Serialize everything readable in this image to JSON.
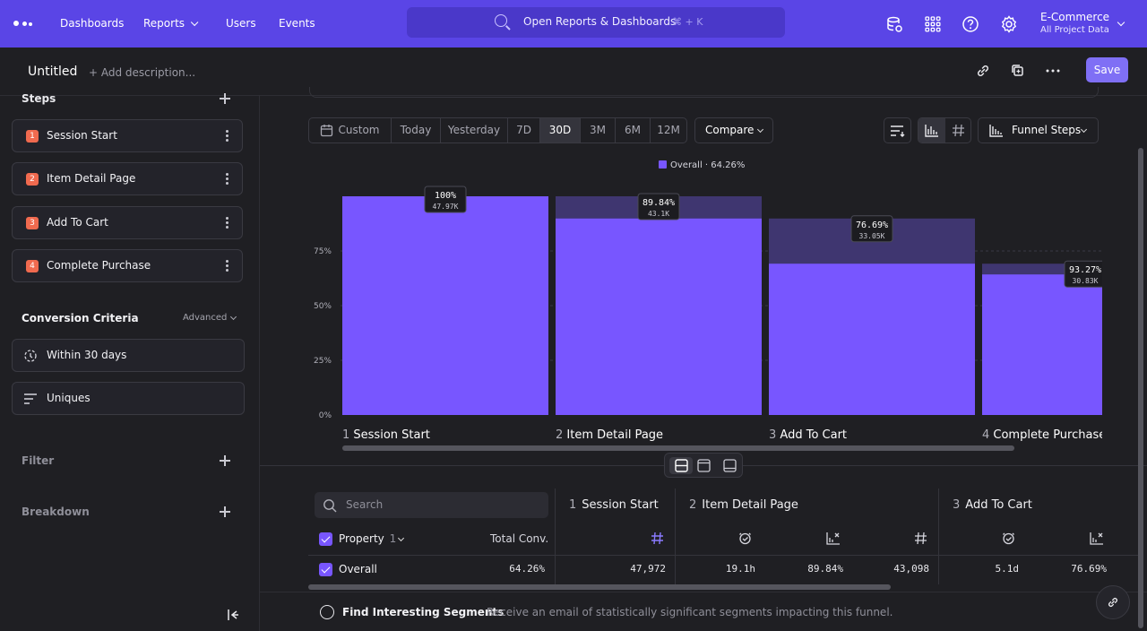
{
  "nav": {
    "links": [
      "Dashboards",
      "Reports",
      "Users",
      "Events"
    ],
    "search_text": "Open Reports & Dashboards",
    "search_shortcut": "⌘ + K",
    "project_name": "E-Commerce",
    "project_sub": "All Project Data"
  },
  "report": {
    "title": "Untitled",
    "add_description": "+ Add description...",
    "save_label": "Save"
  },
  "sidebar": {
    "steps_label": "Steps",
    "steps": [
      {
        "num": "1",
        "label": "Session Start"
      },
      {
        "num": "2",
        "label": "Item Detail Page"
      },
      {
        "num": "3",
        "label": "Add To Cart"
      },
      {
        "num": "4",
        "label": "Complete Purchase"
      }
    ],
    "conversion_label": "Conversion Criteria",
    "advanced_label": "Advanced",
    "window_label": "Within 30 days",
    "counting_label": "Uniques",
    "filter_label": "Filter",
    "breakdown_label": "Breakdown"
  },
  "controls": {
    "date_segments": [
      "Custom",
      "Today",
      "Yesterday",
      "7D",
      "30D",
      "3M",
      "6M",
      "12M"
    ],
    "active_date": "30D",
    "compare_label": "Compare",
    "view_label": "Funnel Steps"
  },
  "chart_data": {
    "type": "bar",
    "legend": "Overall · 64.26%",
    "yticks": [
      "0%",
      "25%",
      "50%",
      "75%"
    ],
    "ylim": [
      0,
      100
    ],
    "categories": [
      "Session Start",
      "Item Detail Page",
      "Add To Cart",
      "Complete Purchase"
    ],
    "category_nums": [
      "1",
      "2",
      "3",
      "4"
    ],
    "values": [
      100,
      89.84,
      69.18,
      64.26
    ],
    "previous_values": [
      100,
      100,
      89.84,
      69.18
    ],
    "pct_labels": [
      "100%",
      "89.84%",
      "76.69%",
      "93.27%"
    ],
    "count_labels": [
      "47.97K",
      "43.1K",
      "33.05K",
      "30.83K"
    ],
    "colors": {
      "bar": "#7856ff",
      "dropoff": "#3f3670"
    }
  },
  "table": {
    "search_placeholder": "Search",
    "property_label": "Property",
    "property_count": "1",
    "total_conv_label": "Total Conv.",
    "columns": [
      {
        "num": "1",
        "label": "Session Start"
      },
      {
        "num": "2",
        "label": "Item Detail Page"
      },
      {
        "num": "3",
        "label": "Add To Cart"
      }
    ],
    "row": {
      "name": "Overall",
      "total_conv": "64.26%",
      "values": [
        "47,972",
        "19.1h",
        "89.84%",
        "43,098",
        "5.1d",
        "76.69%"
      ]
    }
  },
  "footer": {
    "title": "Find Interesting Segments",
    "description": "Receive an email of statistically significant segments impacting this funnel."
  }
}
